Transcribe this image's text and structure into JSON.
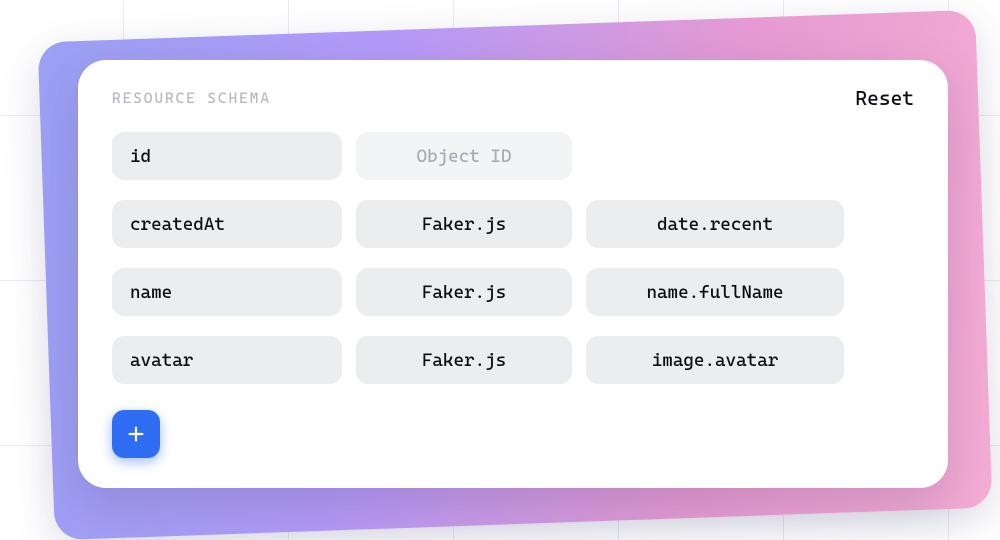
{
  "header": {
    "title": "RESOURCE SCHEMA",
    "reset_label": "Reset"
  },
  "fields": [
    {
      "name": "id",
      "type": "Object ID",
      "option": null,
      "type_soft": true
    },
    {
      "name": "createdAt",
      "type": "Faker.js",
      "option": "date.recent",
      "type_soft": false
    },
    {
      "name": "name",
      "type": "Faker.js",
      "option": "name.fullName",
      "type_soft": false
    },
    {
      "name": "avatar",
      "type": "Faker.js",
      "option": "image.avatar",
      "type_soft": false
    }
  ],
  "icons": {
    "add": "plus-icon"
  },
  "colors": {
    "accent": "#2f6ef2",
    "gradient_from": "#9aa1f4",
    "gradient_to": "#f4add4",
    "pill_bg": "#ecedef",
    "pill_soft_bg": "#f3f4f5"
  }
}
